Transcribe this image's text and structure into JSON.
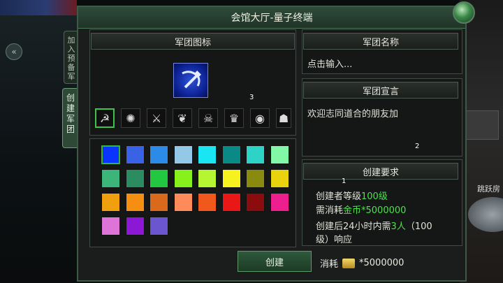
{
  "window": {
    "title": "会馆大厅-量子终端"
  },
  "side_tabs": {
    "join_reserve": "加入预备军",
    "create_legion": "创建军团"
  },
  "emblem_section": {
    "header": "军团图标",
    "selected_emblem": "blue-hammer-sickle",
    "emblems": [
      "hammer-sickle",
      "burst",
      "crossed-blades",
      "winged",
      "skull",
      "crowned-skull",
      "eye",
      "demon-mask"
    ]
  },
  "color_palette": {
    "selected_color": "#0a34ff",
    "colors": [
      "#0a34ff",
      "#3a62e4",
      "#2b8be6",
      "#93c9e6",
      "#19e6f2",
      "#0a8a86",
      "#2ed3c7",
      "#82f8a6",
      "#3bb57a",
      "#2b8c62",
      "#22c940",
      "#87f21b",
      "#b5f531",
      "#f6f21f",
      "#8a8a0f",
      "#e9d30e",
      "#f0a00e",
      "#f58e11",
      "#d96a1c",
      "#ff8b5a",
      "#f0581c",
      "#ea1717",
      "#8a0c0c",
      "#ed1f8e",
      "#df74d8",
      "#8c17d4",
      "#6c56cf"
    ]
  },
  "name_section": {
    "header": "军团名称",
    "placeholder": "点击输入..."
  },
  "declaration_section": {
    "header": "军团宣言",
    "text": "欢迎志同道合的朋友加"
  },
  "requirements": {
    "header": "创建要求",
    "line1_prefix": "创建者等级",
    "line1_value": "100级",
    "line2_prefix": "需消耗",
    "line2_value": "金币*5000000",
    "line3_prefix": "创建后24小时内需",
    "line3_value": "3人",
    "line3_suffix": "（100",
    "line4": "级）响应"
  },
  "footer": {
    "create_label": "创建",
    "cost_label": "消耗",
    "cost_value": "*5000000"
  },
  "background": {
    "right_text": "跳跃房"
  },
  "markers": {
    "m1": "1",
    "m2": "2",
    "m3": "3"
  }
}
